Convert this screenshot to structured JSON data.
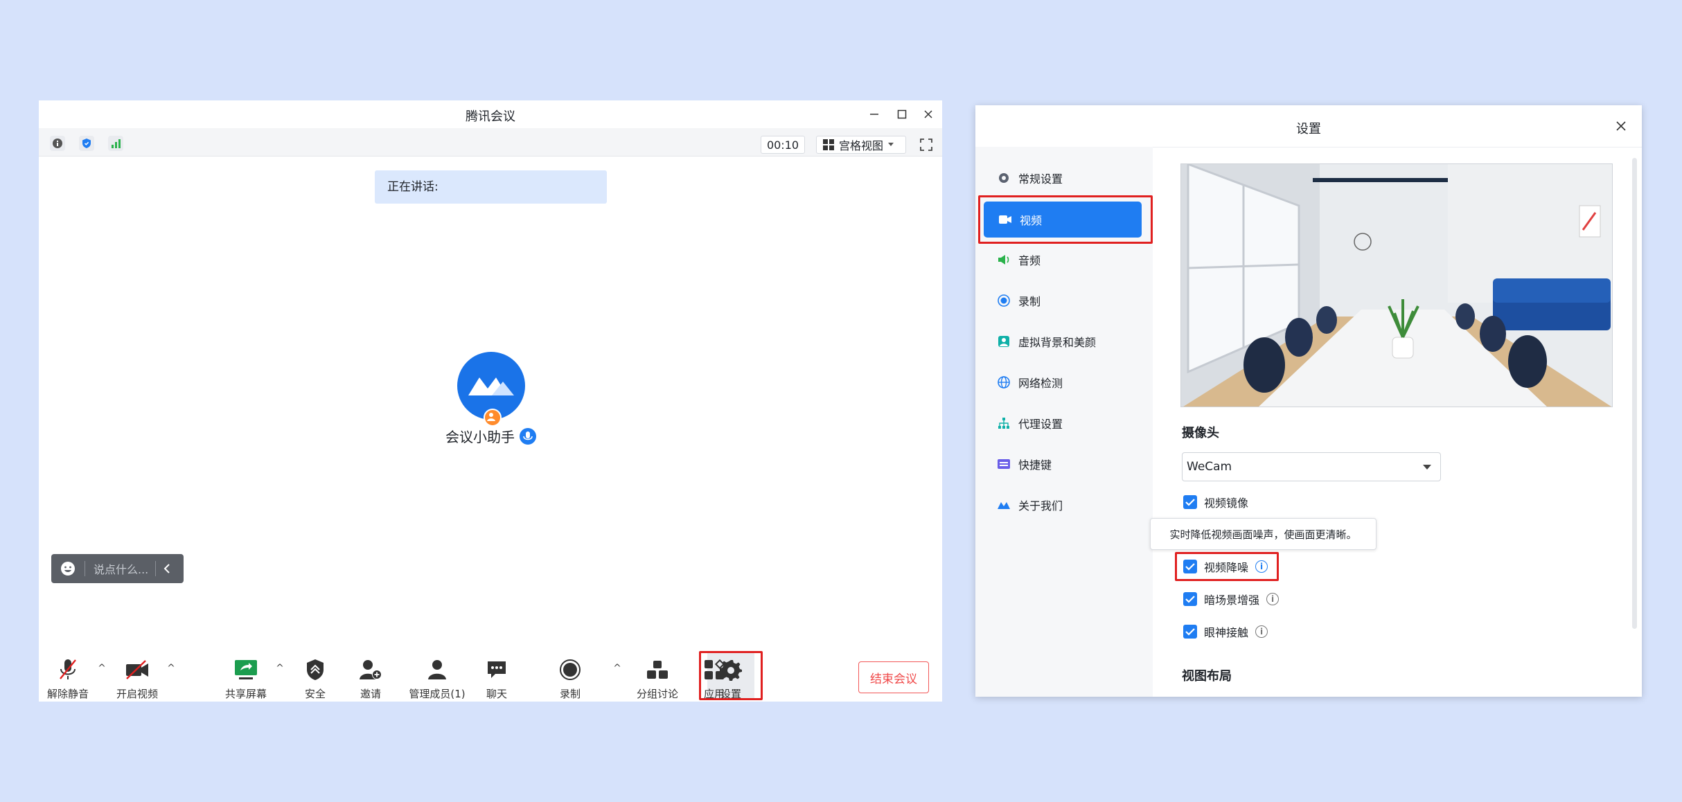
{
  "meeting": {
    "title": "腾讯会议",
    "timer": "00:10",
    "view_label": "宫格视图",
    "speaking_label": "正在讲话:",
    "participant_name": "会议小助手",
    "chat_placeholder": "说点什么...",
    "toolbar": {
      "unmute": "解除静音",
      "start_video": "开启视频",
      "share_screen": "共享屏幕",
      "security": "安全",
      "invite": "邀请",
      "manage_members": "管理成员(1)",
      "chat": "聊天",
      "record": "录制",
      "breakout": "分组讨论",
      "apps": "应用",
      "settings": "设置",
      "end_meeting": "结束会议"
    }
  },
  "settings": {
    "title": "设置",
    "nav": [
      {
        "label": "常规设置",
        "icon": "gear-icon"
      },
      {
        "label": "视频",
        "icon": "camera-icon"
      },
      {
        "label": "音频",
        "icon": "speaker-icon"
      },
      {
        "label": "录制",
        "icon": "record-icon"
      },
      {
        "label": "虚拟背景和美颜",
        "icon": "portrait-icon"
      },
      {
        "label": "网络检测",
        "icon": "globe-icon"
      },
      {
        "label": "代理设置",
        "icon": "network-icon"
      },
      {
        "label": "快捷键",
        "icon": "keyboard-icon"
      },
      {
        "label": "关于我们",
        "icon": "logo-icon"
      }
    ],
    "camera_section": "摄像头",
    "camera_value": "WeCam",
    "tooltip": "实时降低视频画面噪声，使画面更清晰。",
    "options": {
      "mirror": "视频镜像",
      "denoise": "视频降噪",
      "lowlight": "暗场景增强",
      "eye_contact": "眼神接触"
    },
    "layout_section": "视图布局"
  },
  "colors": {
    "background": "#d6e2fb",
    "accent": "#1f7df2",
    "highlight_box": "#e02020",
    "end_button": "#f04848"
  }
}
